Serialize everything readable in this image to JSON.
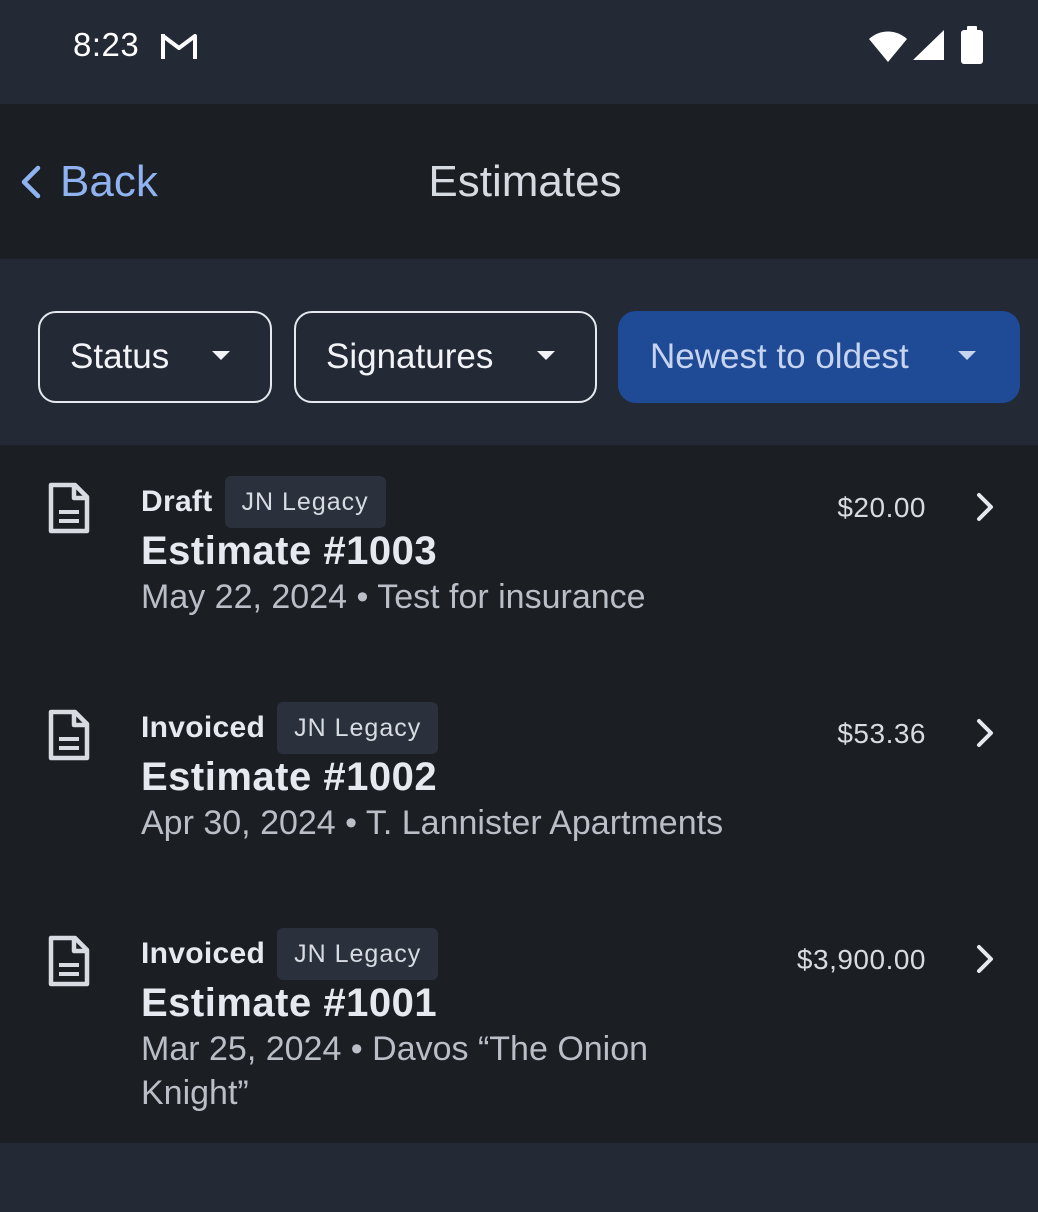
{
  "status_bar": {
    "time": "8:23",
    "icons": [
      "gmail-icon",
      "wifi-icon",
      "signal-icon",
      "battery-icon"
    ]
  },
  "header": {
    "back_label": "Back",
    "title": "Estimates"
  },
  "filters": {
    "status_label": "Status",
    "signatures_label": "Signatures",
    "sort_label": "Newest to oldest"
  },
  "estimates": [
    {
      "status": "Draft",
      "tag": "JN Legacy",
      "title": "Estimate #1003",
      "subtitle": "May 22, 2024 • Test for insurance",
      "amount": "$20.00"
    },
    {
      "status": "Invoiced",
      "tag": "JN Legacy",
      "title": "Estimate #1002",
      "subtitle": "Apr 30, 2024 • T. Lannister Apartments",
      "amount": "$53.36"
    },
    {
      "status": "Invoiced",
      "tag": "JN Legacy",
      "title": "Estimate #1001",
      "subtitle": "Mar 25, 2024 • Davos “The Onion Knight”",
      "amount": "$3,900.00"
    }
  ],
  "colors": {
    "accent": "#8fb2f0",
    "sort_button": "#1f4a96",
    "background": "#1b1e23",
    "surface": "#232a35"
  }
}
